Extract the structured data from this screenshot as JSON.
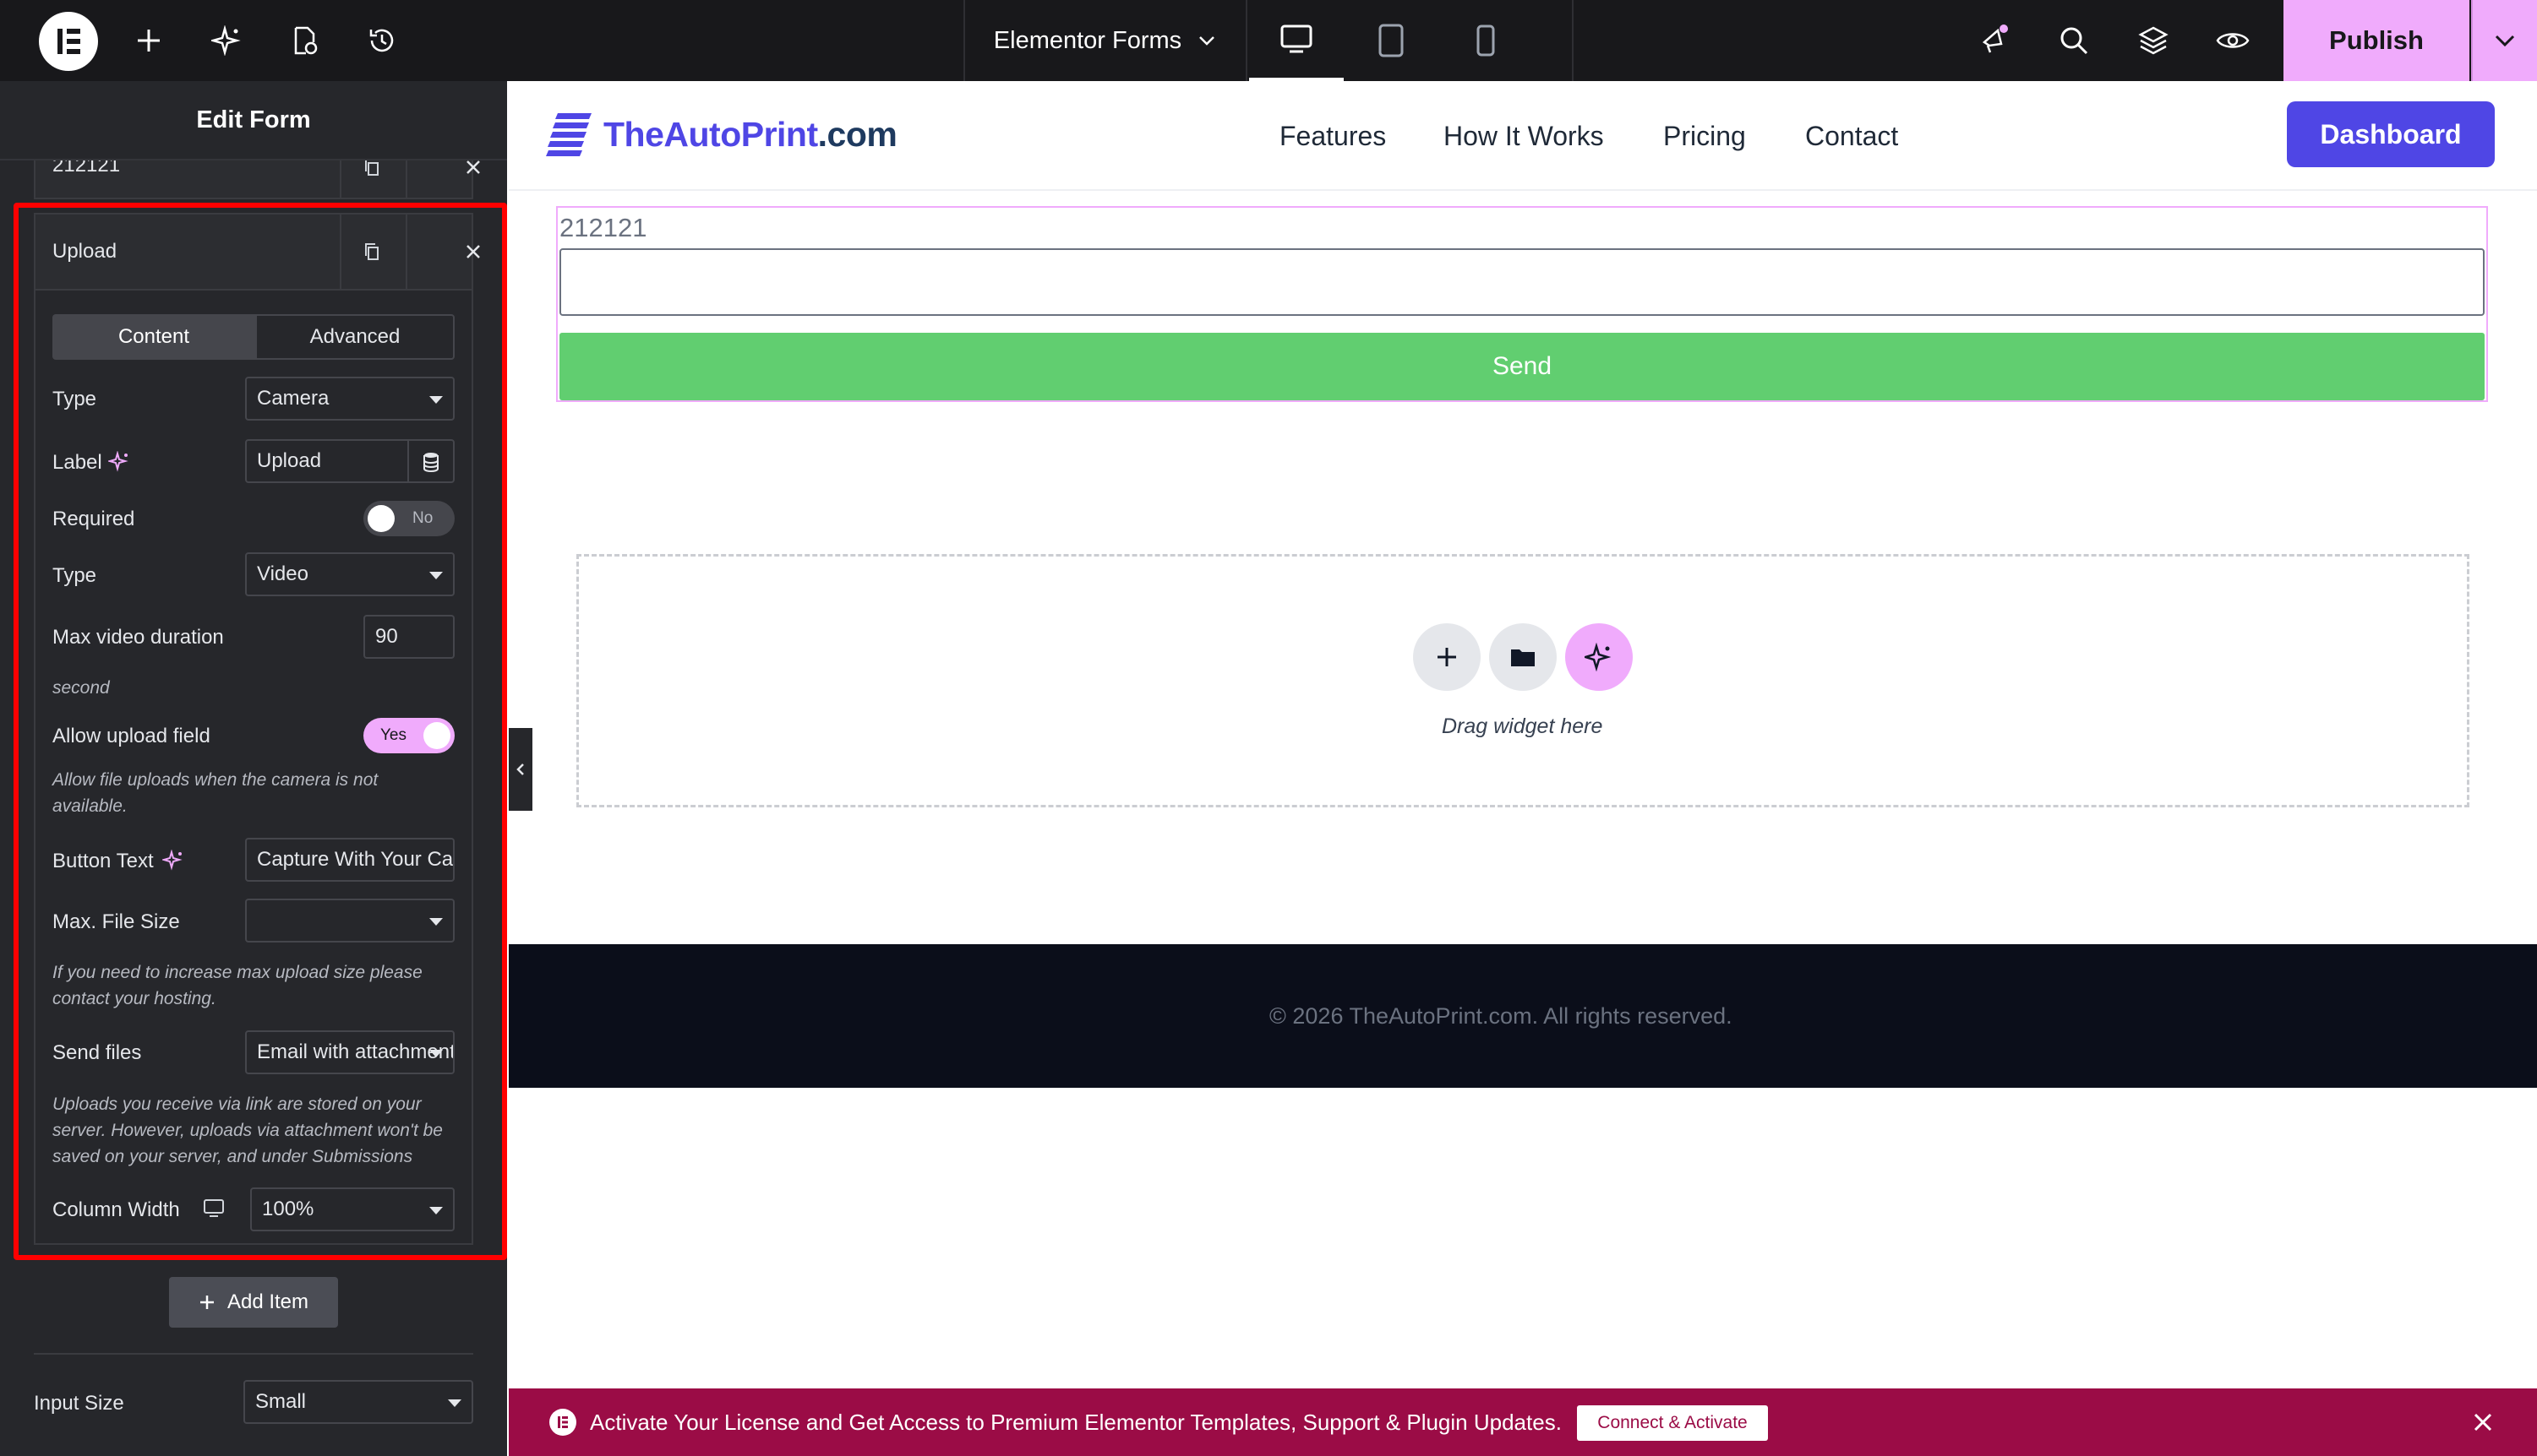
{
  "topbar": {
    "document_title": "Elementor Forms",
    "publish_label": "Publish"
  },
  "panel": {
    "title": "Edit Form",
    "prev_item_label": "212121",
    "item": {
      "title": "Upload",
      "tabs": [
        "Content",
        "Advanced"
      ],
      "type_label": "Type",
      "type_value": "Camera",
      "label_label": "Label",
      "label_value": "Upload",
      "required_label": "Required",
      "required_state": "No",
      "media_type_label": "Type",
      "media_type_value": "Video",
      "max_duration_label": "Max video duration",
      "max_duration_value": "90",
      "duration_unit": "second",
      "allow_upload_label": "Allow upload field",
      "allow_upload_state": "Yes",
      "allow_upload_note": "Allow file uploads when the camera is not available.",
      "button_text_label": "Button Text",
      "button_text_value": "Capture With Your Camera",
      "max_file_size_label": "Max. File Size",
      "max_file_size_value": "",
      "max_file_size_note": "If you need to increase max upload size please contact your hosting.",
      "send_files_label": "Send files",
      "send_files_value": "Email with attachment",
      "send_files_note": "Uploads you receive via link are stored on your server. However, uploads via attachment won't be saved on your server, and under Submissions",
      "column_width_label": "Column Width",
      "column_width_value": "100%"
    },
    "add_item_label": "Add Item",
    "input_size_label": "Input Size",
    "input_size_value": "Small"
  },
  "site": {
    "logo_name": "TheAutoPrint",
    "logo_tld": ".com",
    "nav": [
      "Features",
      "How It Works",
      "Pricing",
      "Contact"
    ],
    "dashboard_label": "Dashboard",
    "form_field_label": "212121",
    "send_label": "Send",
    "drop_text": "Drag widget here",
    "footer_text": "© 2026 TheAutoPrint.com. All rights reserved."
  },
  "banner": {
    "text": "Activate Your License and Get Access to Premium Elementor Templates, Support & Plugin Updates.",
    "button_label": "Connect & Activate"
  },
  "colors": {
    "accent_pink": "#f0abfc",
    "brand_blue": "#4f46e5",
    "send_green": "#61ce70",
    "highlight_red": "#ff0000",
    "banner_red": "#9b0c46"
  },
  "icons": [
    "elementor-logo-icon",
    "plus-icon",
    "sparkle-ai-icon",
    "page-settings-icon",
    "history-icon",
    "chevron-down-icon",
    "desktop-icon",
    "tablet-icon",
    "mobile-icon",
    "notifications-icon",
    "search-icon",
    "layers-icon",
    "preview-eye-icon",
    "copy-icon",
    "close-icon",
    "database-icon",
    "folder-icon",
    "collapse-arrow-icon"
  ]
}
